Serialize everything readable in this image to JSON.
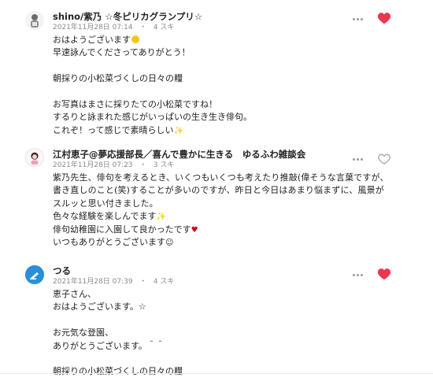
{
  "colors": {
    "liked_heart": "#e8384f",
    "unliked_heart": "#b0b0b0",
    "meta_text": "#8a8a8a"
  },
  "comments": [
    {
      "author": "shino/紫乃 ☆冬ピリカグランプリ☆",
      "date": "2021年11月28日 07:14",
      "separator": "・",
      "likes": "4 スキ",
      "liked": true,
      "lines": [
        "おはようございます",
        "早速詠んでくださってありがとう！",
        "",
        "朝採りの小松菜づくしの日々の糧",
        "",
        "お写真はまさに採りたての小松菜ですね！",
        "するりと詠まれた感じがいっぱいの生き生き俳句。",
        "これぞ！って感じで素晴らしい"
      ]
    },
    {
      "author": "江村恵子@夢応援部長／喜んで豊かに生きる　ゆるふわ雑談会",
      "date": "2021年11月28日 07:23",
      "separator": "・",
      "likes": "3 スキ",
      "liked": false,
      "lines": [
        "紫乃先生、俳句を考えるとき、いくつもいくつも考えたり推敲(偉そうな言葉ですが、書き直しのこと(笑)することが多いのですが、昨日と今日はあまり悩まずに、風景がスルッと思い付きました。",
        "色々な経験を楽しんでます",
        "俳句幼稚園に入園して良かったです",
        "いつもありがとうございます"
      ]
    },
    {
      "author": "つる",
      "date": "2021年11月28日 07:39",
      "separator": "・",
      "likes": "4 スキ",
      "liked": true,
      "lines": [
        "恵子さん、",
        "おはようございます。☆",
        "",
        "お元気な登園、",
        "ありがとうございます。＾＾",
        "",
        "朝採りの小松菜づくしの日々の糧"
      ]
    }
  ]
}
